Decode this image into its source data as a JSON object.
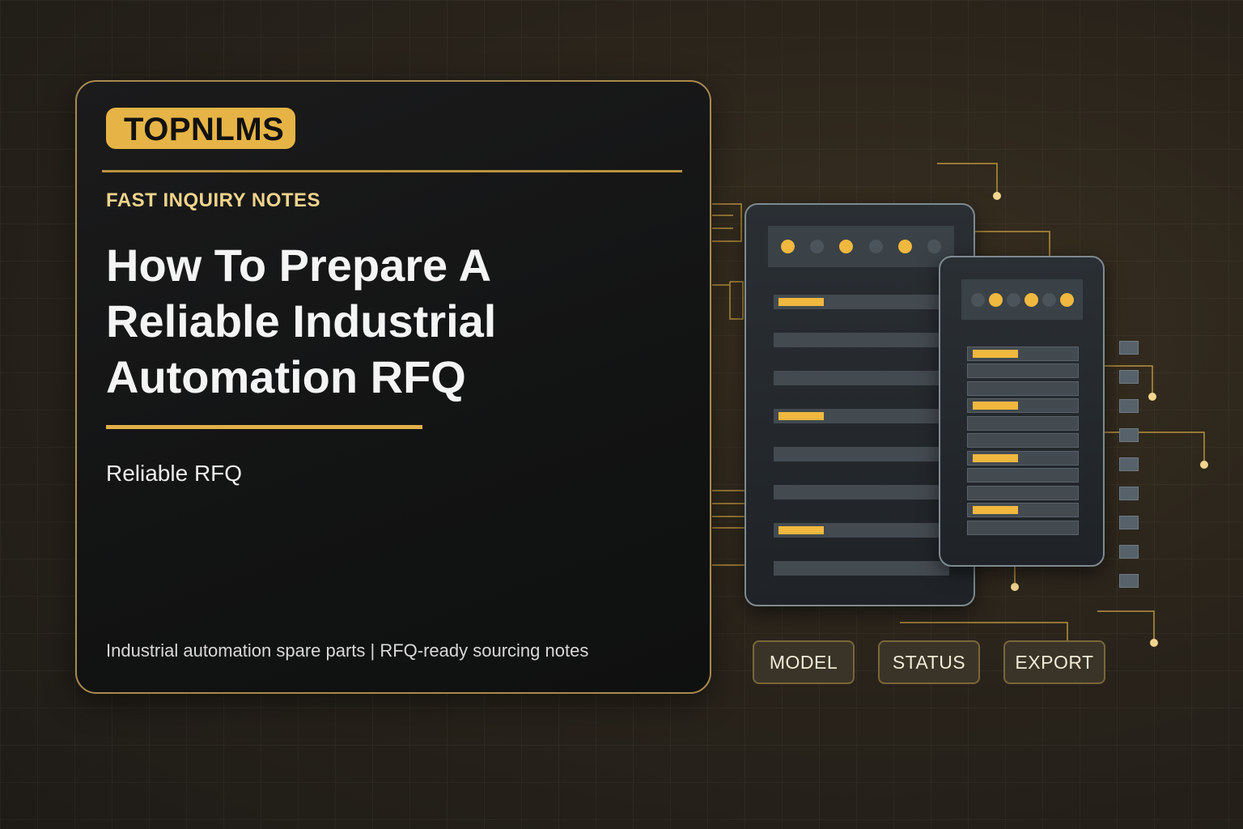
{
  "card": {
    "brand": "TOPNLMS",
    "kicker": "FAST INQUIRY NOTES",
    "title": "How To Prepare A Reliable Industrial Automation RFQ",
    "subtitle": "Reliable RFQ",
    "footer": "Industrial automation spare parts | RFQ-ready sourcing notes"
  },
  "controls": {
    "model_label": "MODEL",
    "status_label": "STATUS",
    "export_label": "EXPORT"
  },
  "colors": {
    "accent": "#e6b446",
    "card_border": "#a88a4f",
    "background": "#2a241b",
    "panel": "#23282c"
  },
  "icons": {
    "big_panel_leds": [
      "on",
      "off",
      "on",
      "off",
      "on",
      "off"
    ],
    "small_panel_leds": [
      "off",
      "on",
      "off",
      "on",
      "off",
      "on"
    ]
  }
}
